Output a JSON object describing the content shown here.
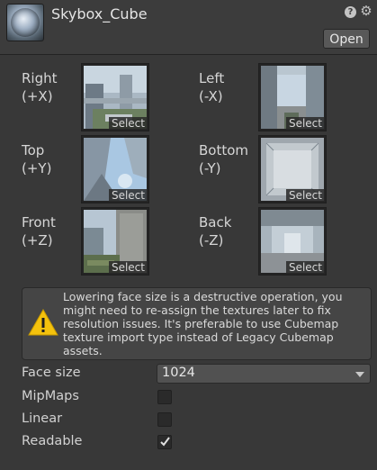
{
  "header": {
    "title": "Skybox_Cube",
    "open_label": "Open",
    "help_icon": "help-icon",
    "settings_icon": "gear-icon"
  },
  "faces": [
    {
      "id": "right",
      "name": "Right",
      "axis": "(+X)",
      "select_label": "Select"
    },
    {
      "id": "left",
      "name": "Left",
      "axis": "(-X)",
      "select_label": "Select"
    },
    {
      "id": "top",
      "name": "Top",
      "axis": "(+Y)",
      "select_label": "Select"
    },
    {
      "id": "bottom",
      "name": "Bottom",
      "axis": "(-Y)",
      "select_label": "Select"
    },
    {
      "id": "front",
      "name": "Front",
      "axis": "(+Z)",
      "select_label": "Select"
    },
    {
      "id": "back",
      "name": "Back",
      "axis": "(-Z)",
      "select_label": "Select"
    }
  ],
  "warning": {
    "icon": "warning-icon",
    "color": "#f4c20d",
    "text": "Lowering face size is a destructive operation, you might need to re-assign the textures later to fix resolution issues. It's preferable to use Cubemap texture import type instead of Legacy Cubemap assets."
  },
  "properties": {
    "face_size": {
      "label": "Face size",
      "value": "1024"
    },
    "mipmaps": {
      "label": "MipMaps",
      "checked": false
    },
    "linear": {
      "label": "Linear",
      "checked": false
    },
    "readable": {
      "label": "Readable",
      "checked": true
    }
  }
}
